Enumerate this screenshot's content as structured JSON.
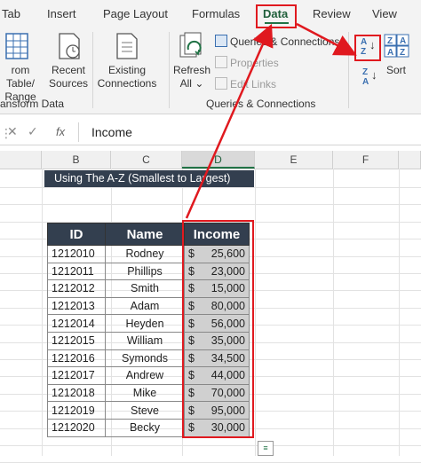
{
  "tabs": [
    "Tab",
    "Insert",
    "Page Layout",
    "Formulas",
    "Data",
    "Review",
    "View"
  ],
  "ribbon": {
    "from_table": [
      "rom Table/",
      "Range"
    ],
    "recent_sources": [
      "Recent",
      "Sources"
    ],
    "existing_connections": [
      "Existing",
      "Connections"
    ],
    "refresh_all": [
      "Refresh",
      "All"
    ],
    "queries_connections": "Queries & Connections",
    "properties": "Properties",
    "edit_links": "Edit Links",
    "sort": "Sort",
    "sort_az": "A→Z",
    "sort_za": "Z→A",
    "group_transform": "ansform Data",
    "group_queries": "Queries & Connections"
  },
  "formula_bar": {
    "fx": "fx",
    "value": "Income"
  },
  "columns": [
    "B",
    "C",
    "D",
    "E",
    "F"
  ],
  "sheet": {
    "title": "Using The A-Z (Smallest to Largest)",
    "headers": [
      "ID",
      "Name",
      "Income"
    ],
    "rows": [
      {
        "id": "1212010",
        "name": "Rodney",
        "cur": "$",
        "income": "25,600"
      },
      {
        "id": "1212011",
        "name": "Phillips",
        "cur": "$",
        "income": "23,000"
      },
      {
        "id": "1212012",
        "name": "Smith",
        "cur": "$",
        "income": "15,000"
      },
      {
        "id": "1212013",
        "name": "Adam",
        "cur": "$",
        "income": "80,000"
      },
      {
        "id": "1212014",
        "name": "Heyden",
        "cur": "$",
        "income": "56,000"
      },
      {
        "id": "1212015",
        "name": "William",
        "cur": "$",
        "income": "35,000"
      },
      {
        "id": "1212016",
        "name": "Symonds",
        "cur": "$",
        "income": "34,500"
      },
      {
        "id": "1212017",
        "name": "Andrew",
        "cur": "$",
        "income": "44,000"
      },
      {
        "id": "1212018",
        "name": "Mike",
        "cur": "$",
        "income": "70,000"
      },
      {
        "id": "1212019",
        "name": "Steve",
        "cur": "$",
        "income": "95,000"
      },
      {
        "id": "1212020",
        "name": "Becky",
        "cur": "$",
        "income": "30,000"
      }
    ]
  },
  "colors": {
    "accent_red": "#e0191f",
    "header_dark": "#333f4f",
    "excel_green": "#217346"
  }
}
